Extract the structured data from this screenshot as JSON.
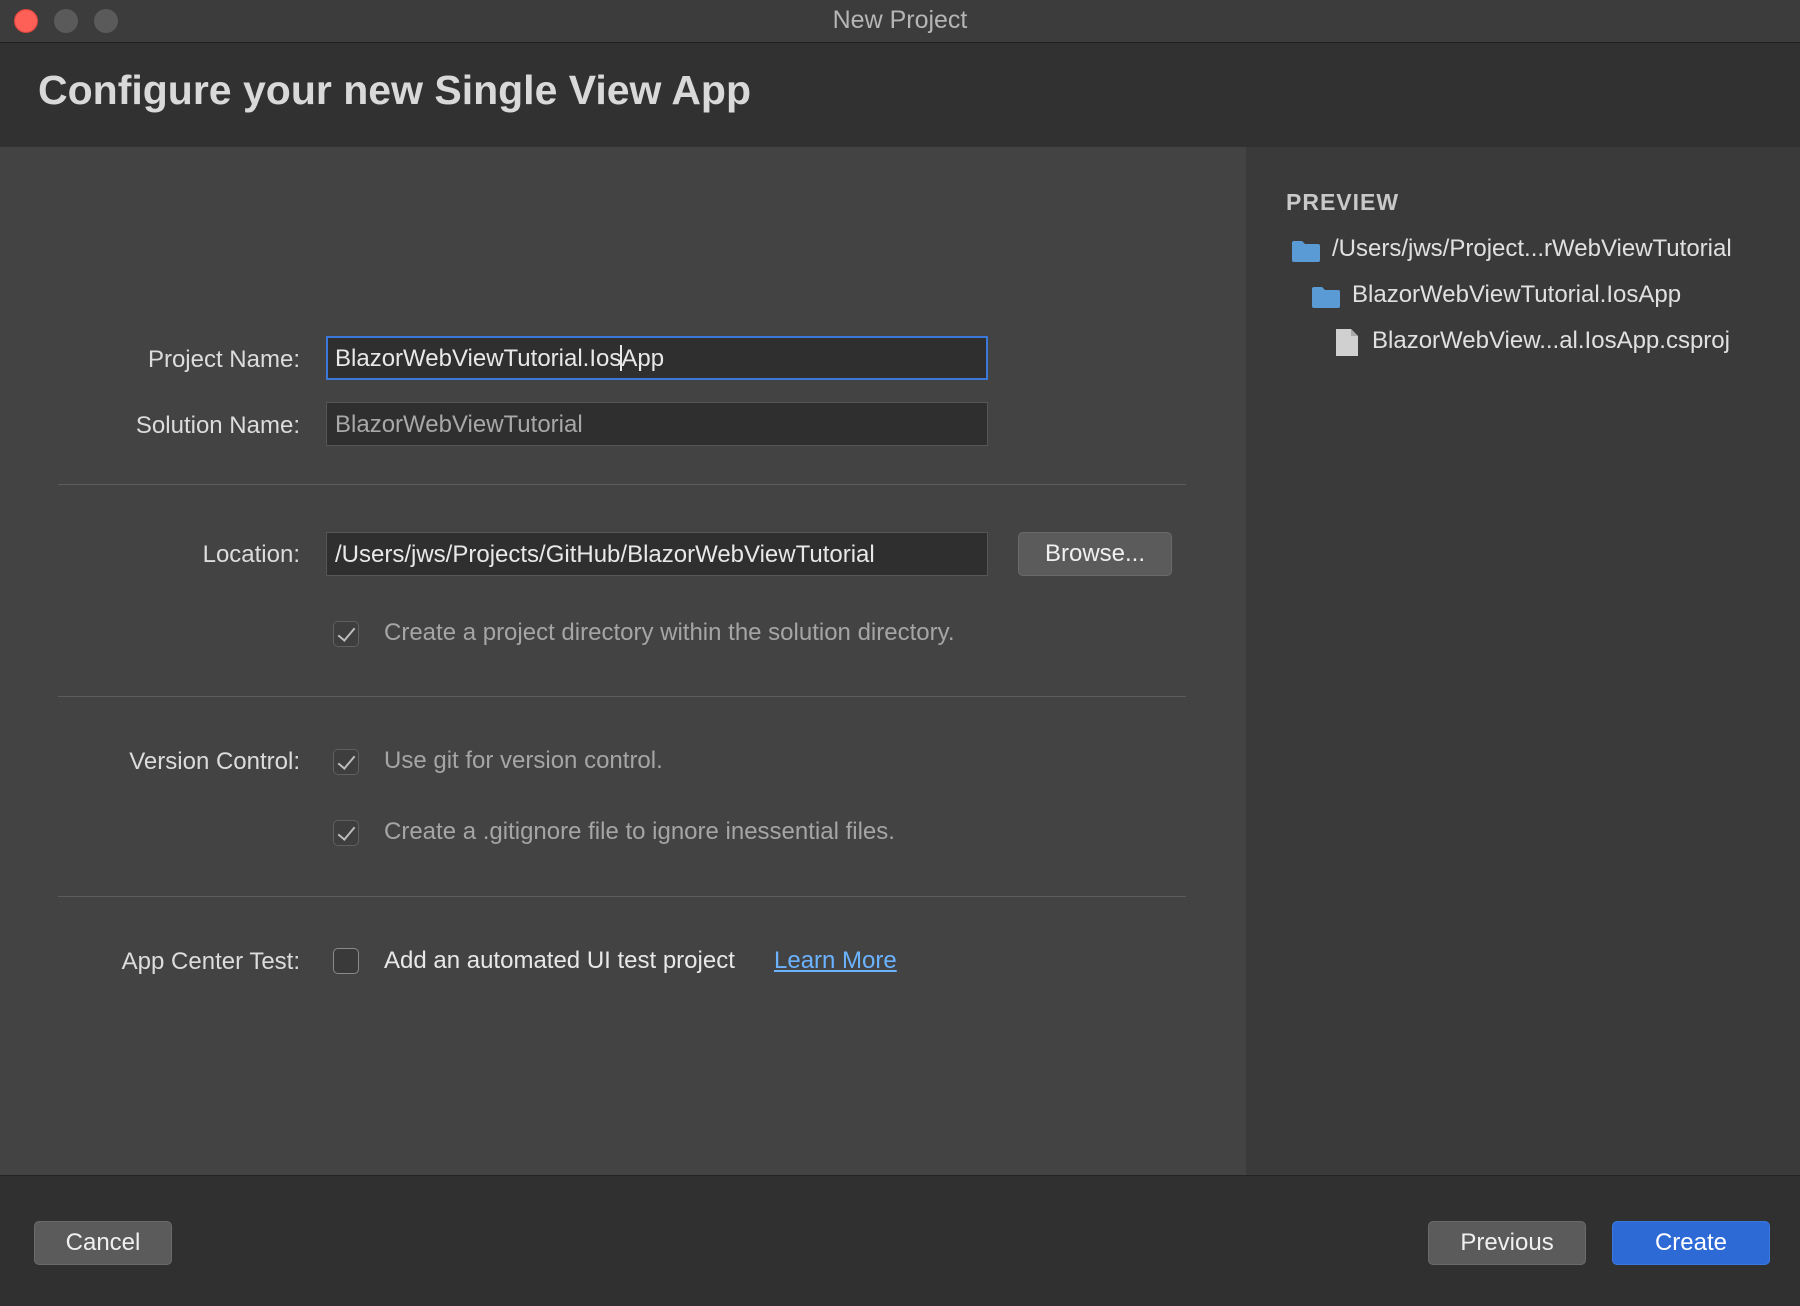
{
  "window": {
    "title": "New Project"
  },
  "header": {
    "title": "Configure your new Single View App"
  },
  "form": {
    "project_name_label": "Project Name:",
    "project_name_before_caret": "BlazorWebViewTutorial.Ios",
    "project_name_after_caret": "App",
    "solution_name_label": "Solution Name:",
    "solution_name_value": "BlazorWebViewTutorial",
    "location_label": "Location:",
    "location_value": "/Users/jws/Projects/GitHub/BlazorWebViewTutorial",
    "browse_label": "Browse...",
    "project_dir_checkbox": {
      "label": "Create a project directory within the solution directory.",
      "checked": true
    },
    "version_control_label": "Version Control:",
    "use_git_checkbox": {
      "label": "Use git for version control.",
      "checked": true
    },
    "gitignore_checkbox": {
      "label": "Create a .gitignore file to ignore inessential files.",
      "checked": true
    },
    "app_center_label": "App Center Test:",
    "app_center_checkbox": {
      "label": "Add an automated UI test project",
      "checked": false
    },
    "learn_more_label": "Learn More"
  },
  "preview": {
    "heading": "PREVIEW",
    "items": [
      {
        "name": "/Users/jws/Project...rWebViewTutorial",
        "icon": "folder-icon"
      },
      {
        "name": "BlazorWebViewTutorial.IosApp",
        "icon": "folder-icon"
      },
      {
        "name": "BlazorWebView...al.IosApp.csproj",
        "icon": "file-icon"
      }
    ]
  },
  "footer": {
    "cancel_label": "Cancel",
    "previous_label": "Previous",
    "create_label": "Create"
  },
  "colors": {
    "accent": "#2d6ad6",
    "link": "#6bb3ff",
    "folder": "#5b9bd5",
    "close_button": "#fe5f57"
  }
}
